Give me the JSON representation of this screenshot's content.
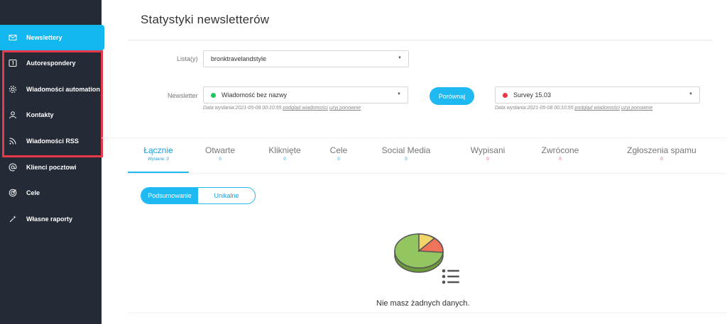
{
  "sidebar": {
    "items": [
      {
        "label": "Newslettery",
        "icon": "envelope-icon",
        "active": true
      },
      {
        "label": "Autorespondery",
        "icon": "calendar-one-icon"
      },
      {
        "label": "Wiadomości automation",
        "icon": "gear-icon"
      },
      {
        "label": "Kontakty",
        "icon": "user-icon"
      },
      {
        "label": "Wiadomości RSS",
        "icon": "rss-icon"
      },
      {
        "label": "Klienci pocztowi",
        "icon": "at-icon"
      },
      {
        "label": "Cele",
        "icon": "target-icon"
      },
      {
        "label": "Własne raporty",
        "icon": "sparkle-icon"
      }
    ]
  },
  "page": {
    "title": "Statystyki newsletterów"
  },
  "list_field": {
    "label": "Lista(y)",
    "value": "bronktravelandstyle"
  },
  "newsletter_field": {
    "label": "Newsletter",
    "value": "Wiadomość bez nazwy",
    "status_color": "#22c55e",
    "sent_label": "Data wysłania:",
    "sent_date": "2021-05-08 00:10:55",
    "preview_link": "podgląd wiadomości",
    "reuse_link": "użyj ponownie"
  },
  "compare_button": {
    "label": "Porównaj"
  },
  "compare_field": {
    "value": "Survey 15.03",
    "status_color": "#e8384a",
    "sent_label": "Data wysłania:",
    "sent_date": "2021-05-08 00:10:55",
    "preview_link": "podgląd wiadomości",
    "reuse_link": "użyj ponownie"
  },
  "tabs": [
    {
      "label": "Łącznie",
      "value": "Wysłane: 0",
      "active": true
    },
    {
      "label": "Otwarte",
      "value": "0"
    },
    {
      "label": "Kliknięte",
      "value": "0"
    },
    {
      "label": "Cele",
      "value": "0"
    },
    {
      "label": "Social Media",
      "value": "0"
    },
    {
      "label": "Wypisani",
      "value": "0"
    },
    {
      "label": "Zwrócone",
      "value": "0"
    },
    {
      "label": "Zgłoszenia spamu",
      "value": "0"
    }
  ],
  "view_toggle": {
    "summary": "Podsumowanie",
    "unique": "Unikalne"
  },
  "empty_state": {
    "message": "Nie masz żadnych danych.",
    "icon": "pie-chart-list-icon"
  },
  "colors": {
    "accent": "#1fb9f2",
    "sidebar_bg": "#242a36",
    "highlight": "#e8384a",
    "negative": "#e05454"
  }
}
